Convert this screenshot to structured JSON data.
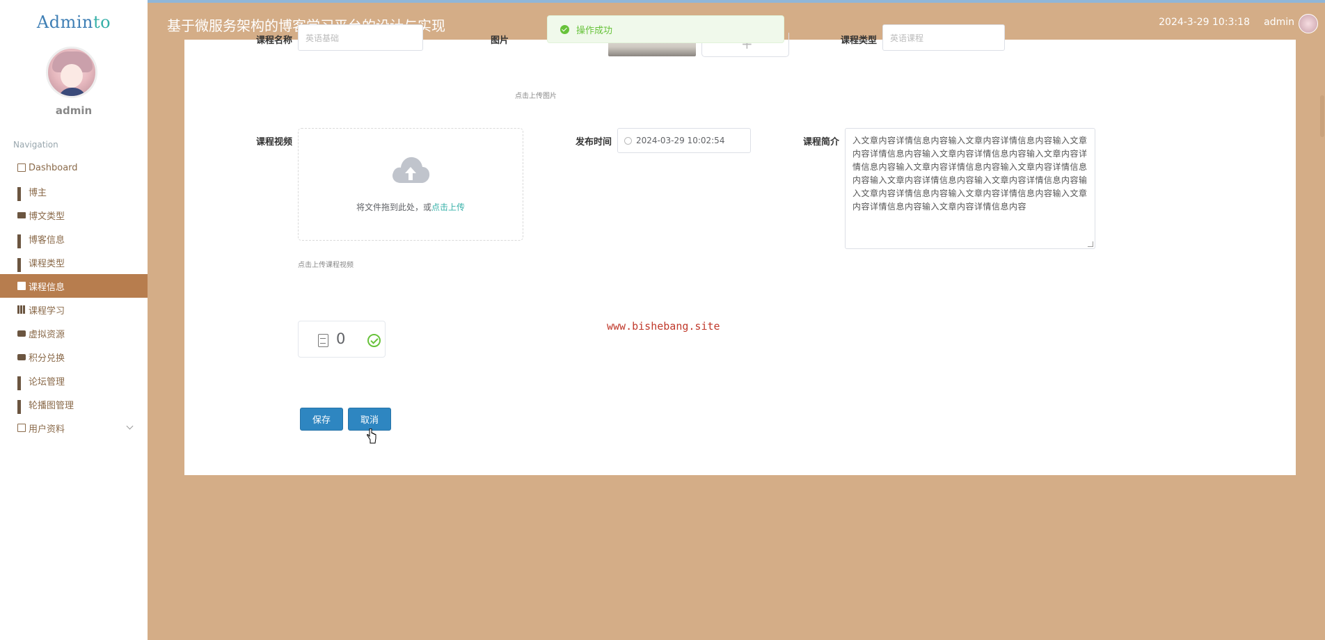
{
  "app": {
    "logo_main": "Admin",
    "logo_accent": "to",
    "title": "基于微服务架构的博客学习平台的设计与实现",
    "datetime": "2024-3-29 10:3:18",
    "user": "admin"
  },
  "sidebar": {
    "username": "admin",
    "nav_title": "Navigation",
    "items": [
      {
        "label": "Dashboard",
        "icon": "home-icon"
      },
      {
        "label": "博主",
        "icon": "grid-icon"
      },
      {
        "label": "博文类型",
        "icon": "briefcase-icon"
      },
      {
        "label": "博客信息",
        "icon": "grid-icon"
      },
      {
        "label": "课程类型",
        "icon": "grid-icon"
      },
      {
        "label": "课程信息",
        "icon": "clipboard-icon",
        "active": true
      },
      {
        "label": "课程学习",
        "icon": "books-icon"
      },
      {
        "label": "虚拟资源",
        "icon": "comment-icon"
      },
      {
        "label": "积分兑换",
        "icon": "comment-icon"
      },
      {
        "label": "论坛管理",
        "icon": "grid-icon"
      },
      {
        "label": "轮播图管理",
        "icon": "grid-icon"
      },
      {
        "label": "用户资料",
        "icon": "folder-icon"
      }
    ]
  },
  "toast": {
    "message": "操作成功",
    "color": "#67c23a"
  },
  "form": {
    "course_name_label": "课程名称",
    "course_name_value": "英语基础",
    "image_label": "图片",
    "image_hint": "点击上传图片",
    "course_type_label": "课程类型",
    "course_type_value": "英语课程",
    "video_label": "课程视频",
    "drop_text": "将文件拖到此处，或",
    "drop_link": "点击上传",
    "video_hint": "点击上传课程视频",
    "publish_label": "发布时间",
    "publish_value": "2024-03-29 10:02:54",
    "intro_label": "课程简介",
    "intro_value": "入文章内容详情信息内容输入文章内容详情信息内容输入文章内容详情信息内容输入文章内容详情信息内容输入文章内容详情信息内容输入文章内容详情信息内容输入文章内容详情信息内容输入文章内容详情信息内容输入文章内容详情信息内容输入文章内容详情信息内容输入文章内容详情信息内容输入文章内容详情信息内容输入文章内容详情信息内容",
    "file_count": "0",
    "save_label": "保存",
    "cancel_label": "取消"
  },
  "watermark": "www.bishebang.site",
  "colors": {
    "background": "#d4ad87",
    "active_menu": "#b77d4e",
    "button": "#2e86c1",
    "link": "#36b0a8"
  }
}
